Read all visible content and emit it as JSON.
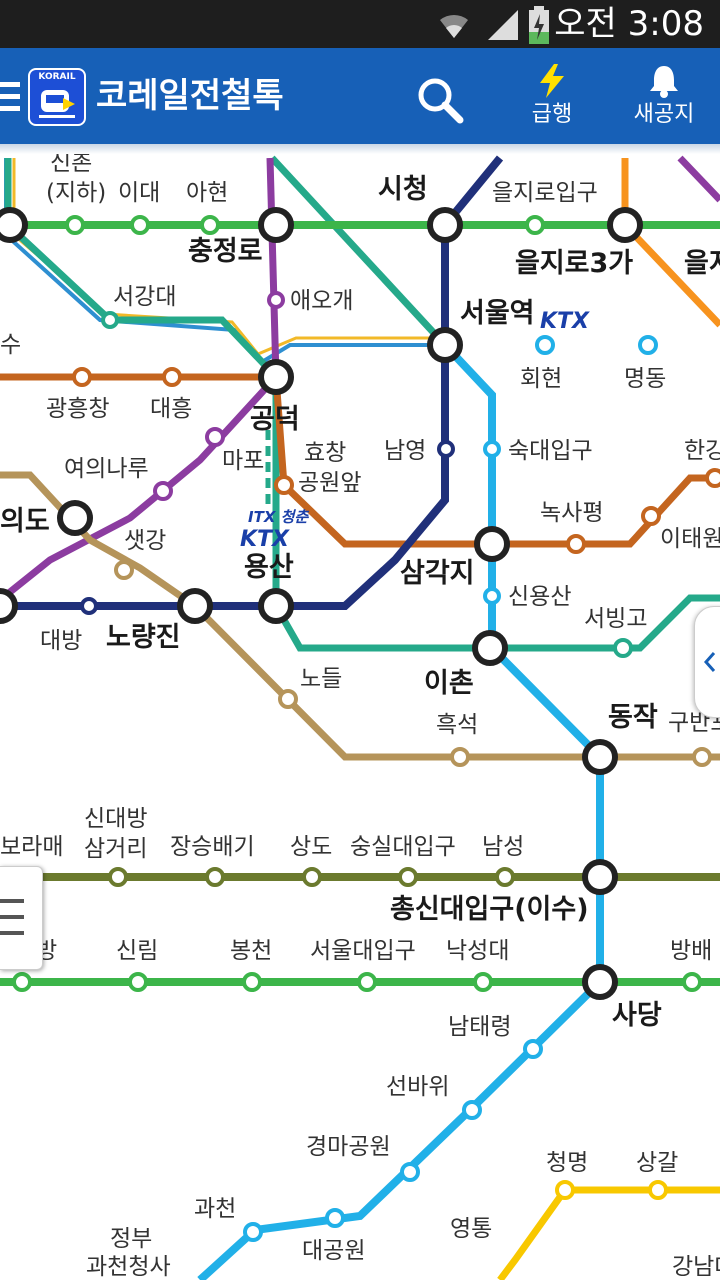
{
  "status_bar": {
    "time": "오전 3:08"
  },
  "app_bar": {
    "title": "코레일전철톡",
    "logo_text": "KORAIL",
    "express_label": "급행",
    "notice_label": "새공지"
  },
  "map": {
    "labels": {
      "sinchon_l1": "신촌",
      "sinchon_l2": "(지하)",
      "idae": "이대",
      "ahyeon": "아현",
      "chungjeongno": "충정로",
      "sicheong": "시청",
      "euljiro1": "을지로입구",
      "euljiro3": "을지로3가",
      "euljiro4": "을지",
      "seogangdae": "서강대",
      "aeogae": "애오개",
      "seoulstation": "서울역",
      "su": "수",
      "gwangheungchang": "광흥창",
      "daeheung": "대흥",
      "gongdeok": "공덕",
      "hoehyeon": "회현",
      "myeongdong": "명동",
      "yeouinaru": "여의나루",
      "mapo": "마포",
      "hyochang_l1": "효창",
      "hyochang_l2": "공원앞",
      "namyeong": "남영",
      "sookmyung": "숙대입구",
      "hangang": "한강",
      "yeouido": "의도",
      "saetgang": "샛강",
      "noksapyeong": "녹사평",
      "itaewon": "이태원",
      "yongsan": "용산",
      "samgakji": "삼각지",
      "sinyongsan": "신용산",
      "seobinggo": "서빙고",
      "daebang": "대방",
      "noryangjin": "노량진",
      "nodeul": "노들",
      "ichon": "이촌",
      "dongjak": "동작",
      "heukseok": "흑석",
      "gubanpo": "구반포",
      "boramae": "보라매",
      "sindaebang_l1": "신대방",
      "sindaebang_l2": "삼거리",
      "jangseungbaegi": "장승배기",
      "sangdo": "상도",
      "soongsil": "숭실대입구",
      "namseong": "남성",
      "chongshin": "총신대입구(이수)",
      "bang": "방",
      "sillim": "신림",
      "bongcheon": "봉천",
      "snu": "서울대입구",
      "nakseongdae": "낙성대",
      "bangbae": "방배",
      "sadang": "사당",
      "namtaeryeong": "남태령",
      "seonbawi": "선바위",
      "gyeongma": "경마공원",
      "cheonggye": "청명",
      "sanggal": "상갈",
      "gwacheon": "과천",
      "jeongbu_l1": "정부",
      "jeongbu_l2": "과천청사",
      "daegongwon": "대공원",
      "yeongtong": "영통",
      "gangnamdae": "강남대"
    },
    "ktx_logo_text": "KTX",
    "itx_logo_text": "ITX 청춘",
    "colors": {
      "line1": "#20307a",
      "line2": "#3cb54a",
      "line3": "#f7931e",
      "line4": "#21b0e8",
      "line5": "#8c3ca0",
      "line6": "#c4651f",
      "line7": "#6b7a2e",
      "line9": "#b5945a",
      "gyeongui": "#25a98a",
      "airport": "#2e8fd1",
      "bundang": "#f8c800",
      "accent": "#1760b7"
    }
  }
}
